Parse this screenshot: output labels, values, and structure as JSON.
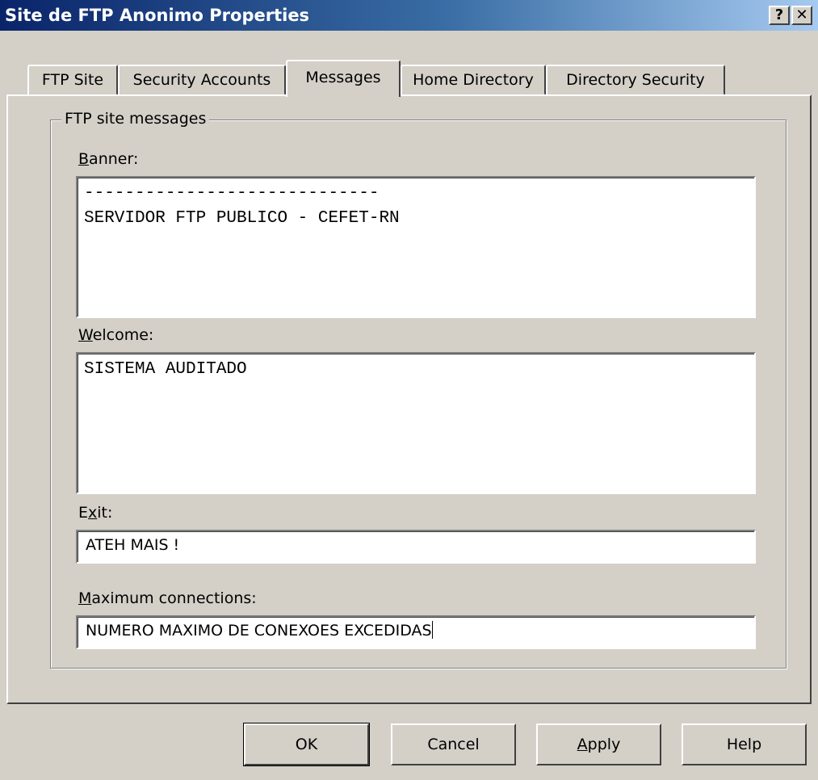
{
  "window": {
    "title": "Site de FTP Anonimo Properties",
    "help_label": "?",
    "close_label": "✕"
  },
  "tabs": [
    {
      "label": "FTP Site",
      "active": false
    },
    {
      "label": "Security Accounts",
      "active": false
    },
    {
      "label": "Messages",
      "active": true
    },
    {
      "label": "Home Directory",
      "active": false
    },
    {
      "label": "Directory Security",
      "active": false
    }
  ],
  "group": {
    "title": "FTP site messages",
    "banner": {
      "label_accel": "B",
      "label_rest": "anner:",
      "value": "-----------------------------\nSERVIDOR FTP PUBLICO - CEFET-RN"
    },
    "welcome": {
      "label_accel": "W",
      "label_rest": "elcome:",
      "value": "SISTEMA AUDITADO"
    },
    "exit": {
      "label_pre": "E",
      "label_accel": "x",
      "label_rest": "it:",
      "value": "ATEH MAIS !"
    },
    "max_connections": {
      "label_accel": "M",
      "label_rest": "aximum connections:",
      "value": "NUMERO MAXIMO DE CONEXOES EXCEDIDAS"
    }
  },
  "buttons": {
    "ok": "OK",
    "cancel": "Cancel",
    "apply_accel": "A",
    "apply_rest": "pply",
    "help": "Help"
  }
}
